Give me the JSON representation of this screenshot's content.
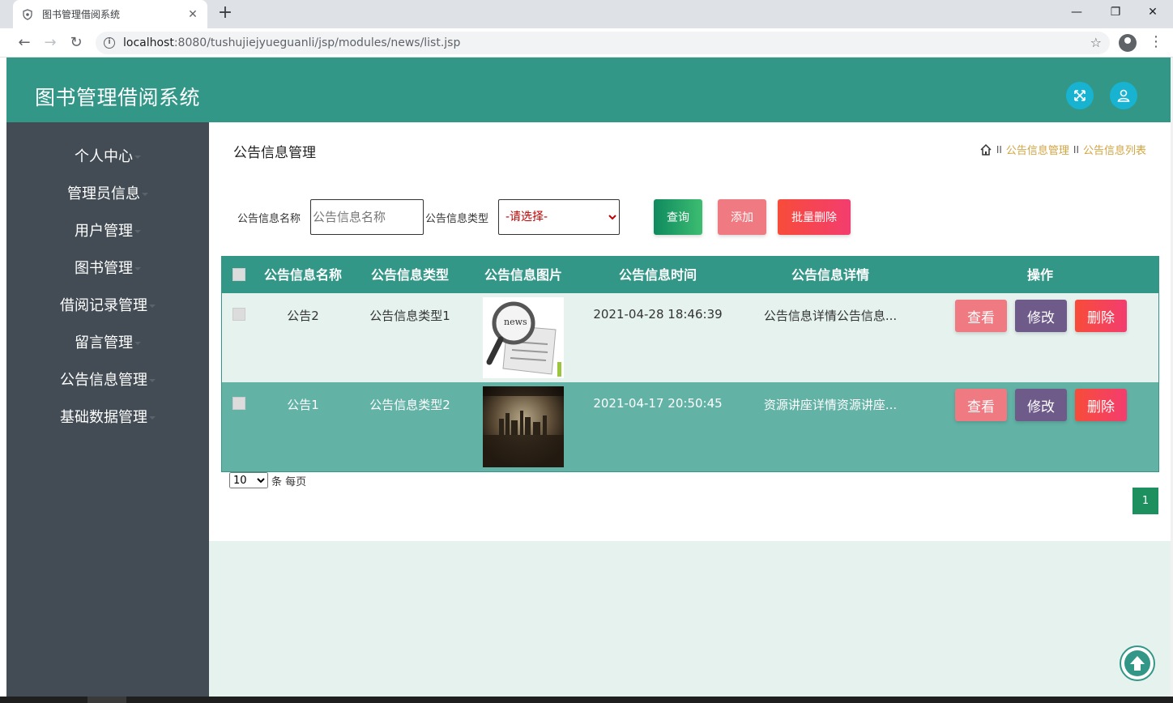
{
  "browser": {
    "tab_title": "图书管理借阅系统",
    "url_host": "localhost",
    "url_rest": ":8080/tushujiejyueguanli/jsp/modules/news/list.jsp"
  },
  "app": {
    "title": "图书管理借阅系统"
  },
  "sidebar": {
    "items": [
      {
        "label": "个人中心"
      },
      {
        "label": "管理员信息"
      },
      {
        "label": "用户管理"
      },
      {
        "label": "图书管理"
      },
      {
        "label": "借阅记录管理"
      },
      {
        "label": "留言管理"
      },
      {
        "label": "公告信息管理"
      },
      {
        "label": "基础数据管理"
      }
    ]
  },
  "page": {
    "heading": "公告信息管理",
    "breadcrumb": [
      "公告信息管理",
      "公告信息列表"
    ],
    "breadcrumb_sep": "II"
  },
  "filters": {
    "name_label": "公告信息名称",
    "name_placeholder": "公告信息名称",
    "name_value": "",
    "type_label": "公告信息类型",
    "type_selected": "-请选择-"
  },
  "actions": {
    "search": "查询",
    "add": "添加",
    "batch_delete": "批量删除"
  },
  "table": {
    "columns": [
      "公告信息名称",
      "公告信息类型",
      "公告信息图片",
      "公告信息时间",
      "公告信息详情",
      "操作"
    ],
    "rows": [
      {
        "name": "公告2",
        "type": "公告信息类型1",
        "image": "newspaper-magnifier-thumbnail",
        "time": "2021-04-28 18:46:39",
        "detail": "公告信息详情公告信息..."
      },
      {
        "name": "公告1",
        "type": "公告信息类型2",
        "image": "city-skyline-thumbnail",
        "time": "2021-04-17 20:50:45",
        "detail": "资源讲座详情资源讲座..."
      }
    ],
    "row_actions": {
      "view": "查看",
      "edit": "修改",
      "delete": "删除"
    }
  },
  "pagination": {
    "page_size": "10",
    "page_size_options": [
      "10"
    ],
    "per_page_label": "条 每页",
    "current_page": "1"
  },
  "colors": {
    "header": "#339788",
    "sidebar": "#434c55",
    "row_odd": "#e6f2ee",
    "row_even": "#63b2a6",
    "btn_view": "#ef7a82",
    "btn_edit": "#6f5b8a",
    "btn_delete": "#f04652"
  }
}
